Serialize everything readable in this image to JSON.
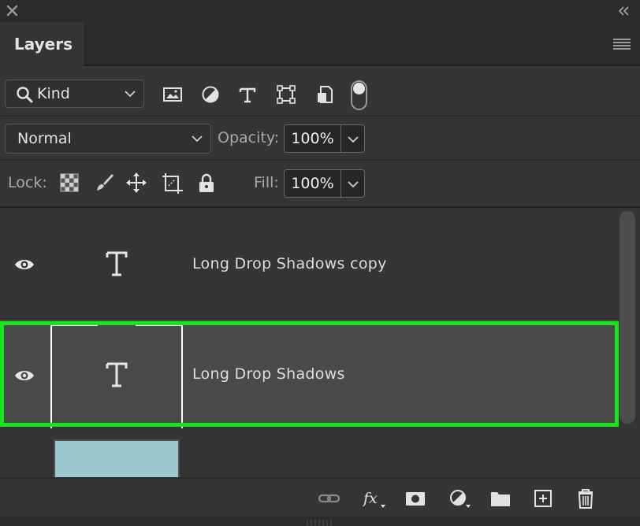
{
  "panel": {
    "tab_title": "Layers"
  },
  "filter": {
    "kind_label": "Kind",
    "icons": [
      "pixel-layer-filter-icon",
      "adjustment-layer-filter-icon",
      "type-layer-filter-icon",
      "shape-layer-filter-icon",
      "smart-object-filter-icon"
    ],
    "filter_toggle_on": true
  },
  "blend": {
    "mode": "Normal",
    "opacity_label": "Opacity:",
    "opacity_value": "100%"
  },
  "lock": {
    "label": "Lock:",
    "icons": [
      "lock-transparent-pixels-icon",
      "lock-image-pixels-icon",
      "lock-position-icon",
      "lock-artboard-icon",
      "lock-all-icon"
    ],
    "fill_label": "Fill:",
    "fill_value": "100%"
  },
  "layers": [
    {
      "name": "Long Drop Shadows copy",
      "type": "text",
      "visible": true,
      "selected": false
    },
    {
      "name": "Long Drop Shadows",
      "type": "text",
      "visible": true,
      "selected": true
    },
    {
      "name": "",
      "type": "image",
      "visible": true,
      "selected": false
    }
  ],
  "bottom_bar": {
    "icons": [
      "link-layers-icon",
      "fx-icon",
      "add-mask-icon",
      "new-adjustment-icon",
      "new-group-icon",
      "new-layer-icon",
      "delete-layer-icon"
    ]
  },
  "colors": {
    "panel_bg": "#353535",
    "selected_row_bg": "#4a4a4a",
    "selection_highlight": "#17e51a",
    "image_thumb": "#9ec8d0"
  }
}
